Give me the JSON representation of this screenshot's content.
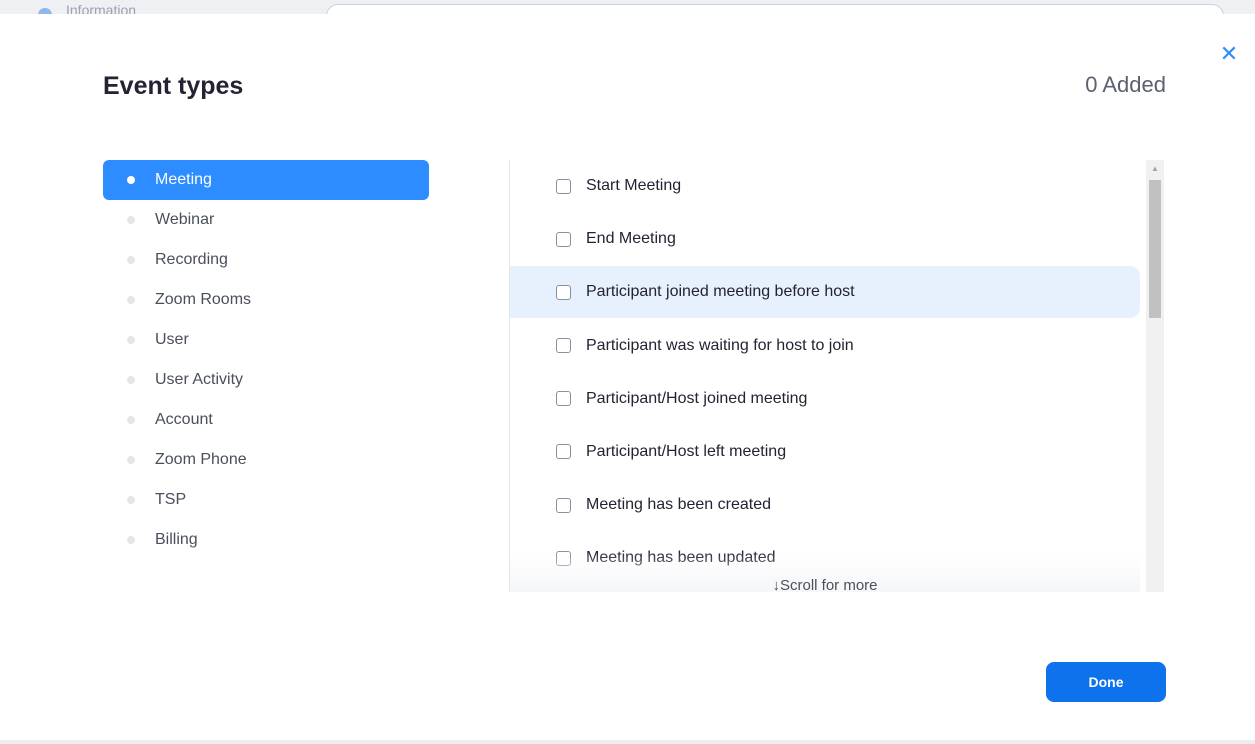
{
  "backdrop": {
    "ghost_label": "Information"
  },
  "modal": {
    "title": "Event types",
    "added_count": "0 Added",
    "close_icon": "close-icon",
    "done_label": "Done",
    "scroll_hint": "↓Scroll for more"
  },
  "categories": [
    {
      "label": "Meeting",
      "active": true
    },
    {
      "label": "Webinar",
      "active": false
    },
    {
      "label": "Recording",
      "active": false
    },
    {
      "label": "Zoom Rooms",
      "active": false
    },
    {
      "label": "User",
      "active": false
    },
    {
      "label": "User Activity",
      "active": false
    },
    {
      "label": "Account",
      "active": false
    },
    {
      "label": "Zoom Phone",
      "active": false
    },
    {
      "label": "TSP",
      "active": false
    },
    {
      "label": "Billing",
      "active": false
    }
  ],
  "events": [
    {
      "label": "Start Meeting",
      "checked": false,
      "hovered": false
    },
    {
      "label": "End Meeting",
      "checked": false,
      "hovered": false
    },
    {
      "label": "Participant joined meeting before host",
      "checked": false,
      "hovered": true
    },
    {
      "label": "Participant was waiting for host to join",
      "checked": false,
      "hovered": false
    },
    {
      "label": "Participant/Host joined meeting",
      "checked": false,
      "hovered": false
    },
    {
      "label": "Participant/Host left meeting",
      "checked": false,
      "hovered": false
    },
    {
      "label": "Meeting has been created",
      "checked": false,
      "hovered": false
    },
    {
      "label": "Meeting has been updated",
      "checked": false,
      "hovered": false
    }
  ],
  "colors": {
    "accent": "#2d8cff",
    "done_button": "#0e72ed",
    "hover_row": "#e6f1fd"
  }
}
